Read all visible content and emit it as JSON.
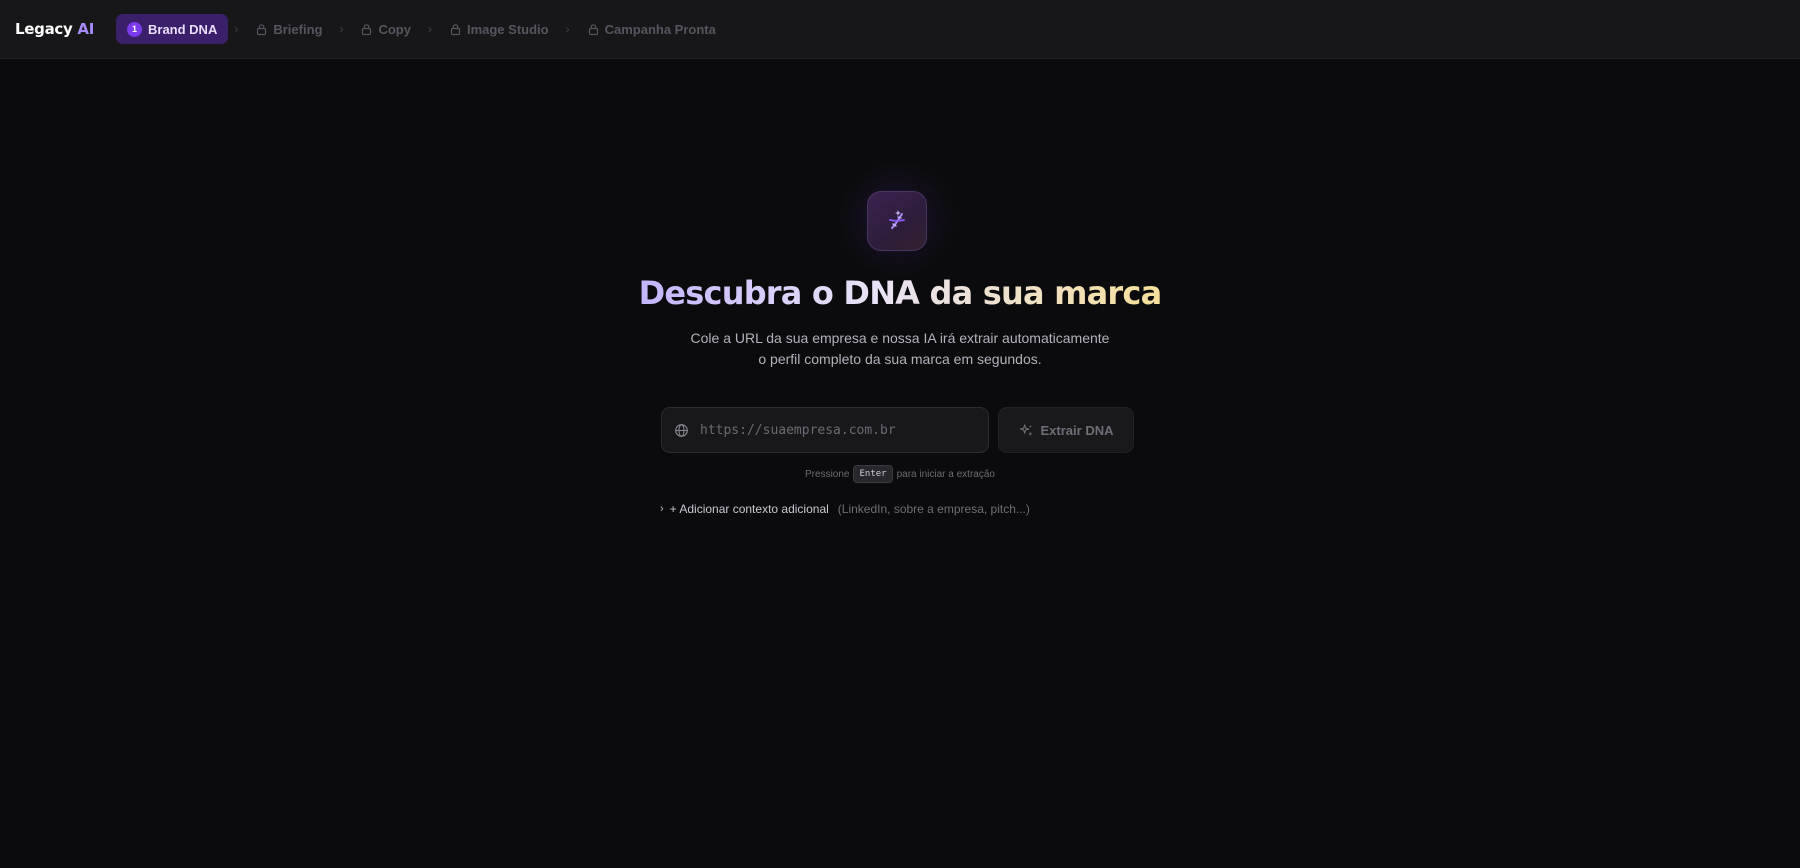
{
  "app": {
    "brand_main": "Legacy",
    "brand_accent": "AI"
  },
  "steps": [
    {
      "number": "1",
      "label": "Brand DNA",
      "state": "active"
    },
    {
      "label": "Briefing",
      "state": "locked"
    },
    {
      "label": "Copy",
      "state": "locked"
    },
    {
      "label": "Image Studio",
      "state": "locked"
    },
    {
      "label": "Campanha Pronta",
      "state": "locked"
    }
  ],
  "hero": {
    "icon": "dna-sparkle-icon",
    "title": "Descubra o DNA da sua marca",
    "subtitle_line1": "Cole a URL da sua empresa e nossa IA irá extrair automaticamente",
    "subtitle_line2": "o perfil completo da sua marca em segundos."
  },
  "url_input": {
    "icon": "globe-icon",
    "value": "",
    "placeholder": "https://suaempresa.com.br"
  },
  "extract_button": {
    "icon": "sparkles-icon",
    "label": "Extrair DNA",
    "enabled": false
  },
  "hint": {
    "prefix": "Pressione",
    "key": "Enter",
    "suffix": "para iniciar a extração"
  },
  "context": {
    "label": "+ Adicionar contexto adicional",
    "hint": "(LinkedIn, sobre a empresa, pitch...)"
  },
  "colors": {
    "background": "#0b0b0d",
    "topbar": "#17171a",
    "accent": "#7c3aed",
    "active_step_bg": "#3a1f6b",
    "title_gradient_start": "#c4b5fd",
    "title_gradient_end": "#f5df9a"
  }
}
